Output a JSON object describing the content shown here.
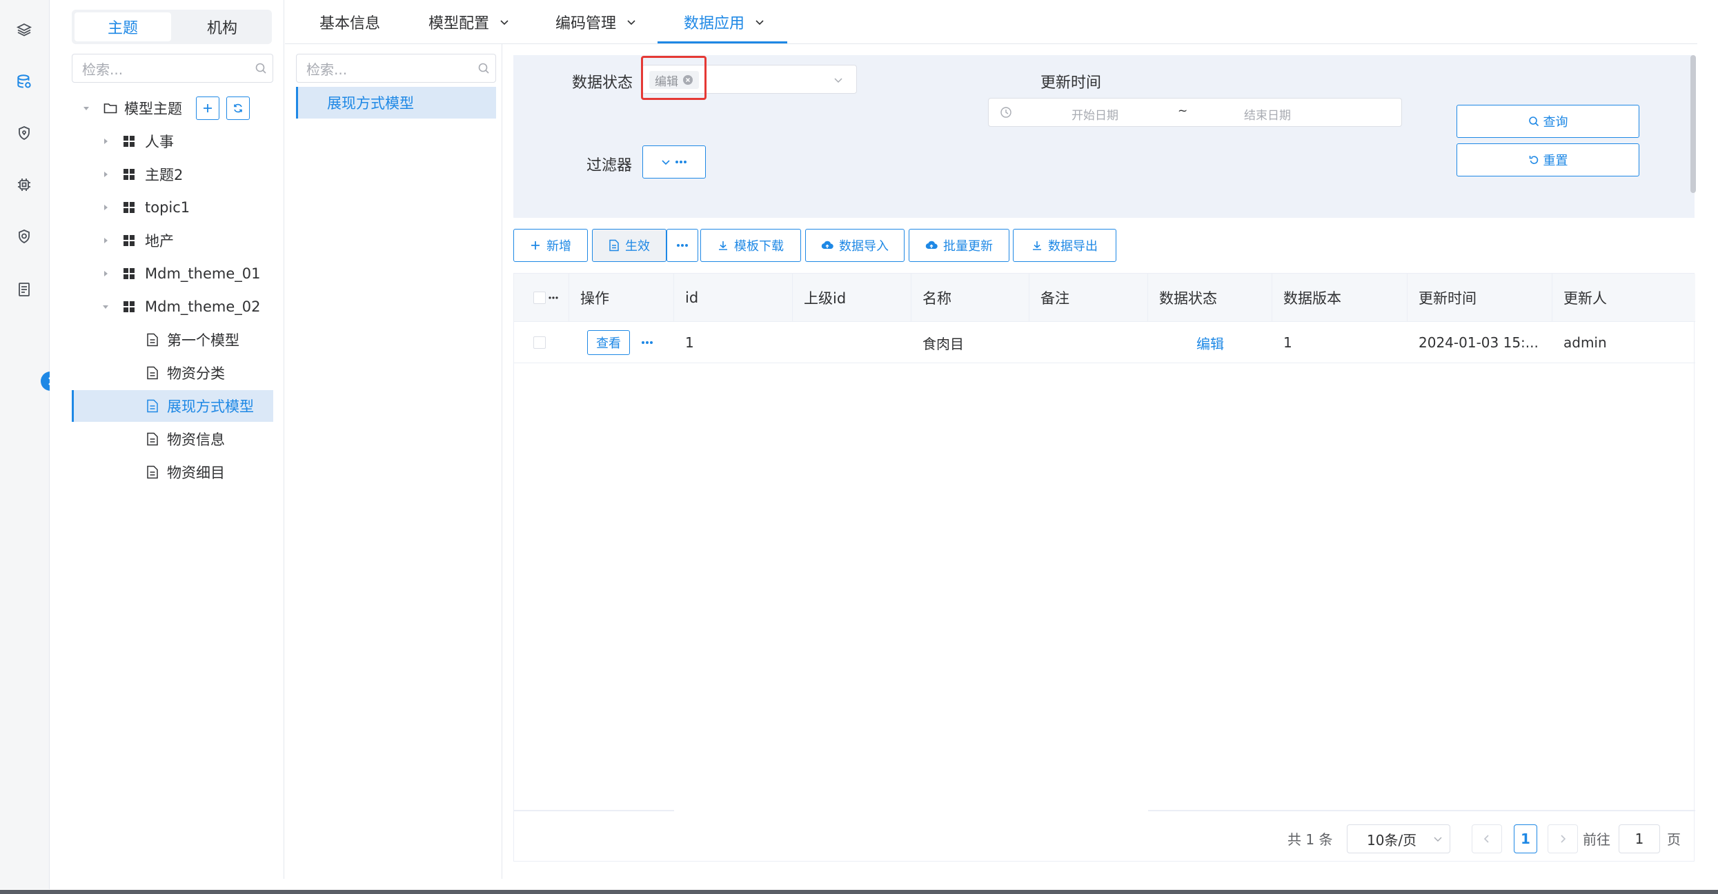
{
  "rail": {
    "icons": [
      "layers-icon",
      "database-icon",
      "shield-icon",
      "chip-icon",
      "shield-check-icon",
      "document-icon"
    ],
    "accent": "#1e88e5"
  },
  "tree_panel": {
    "segment": {
      "active": "主题",
      "inactive": "机构"
    },
    "search_placeholder": "检索...",
    "root": {
      "label": "模型主题"
    },
    "nodes": [
      {
        "label": "人事",
        "level": 1,
        "type": "theme"
      },
      {
        "label": "主题2",
        "level": 1,
        "type": "theme"
      },
      {
        "label": "topic1",
        "level": 1,
        "type": "theme"
      },
      {
        "label": "地产",
        "level": 1,
        "type": "theme"
      },
      {
        "label": "Mdm_theme_01",
        "level": 1,
        "type": "theme"
      },
      {
        "label": "Mdm_theme_02",
        "level": 1,
        "type": "theme",
        "expanded": true
      },
      {
        "label": "第一个模型",
        "level": 2,
        "type": "model"
      },
      {
        "label": "物资分类",
        "level": 2,
        "type": "model"
      },
      {
        "label": "展现方式模型",
        "level": 2,
        "type": "model",
        "selected": true
      },
      {
        "label": "物资信息",
        "level": 2,
        "type": "model"
      },
      {
        "label": "物资细目",
        "level": 2,
        "type": "model"
      }
    ]
  },
  "model_panel": {
    "search_placeholder": "检索...",
    "selected_item": "展现方式模型"
  },
  "tabs": [
    {
      "label": "基本信息",
      "dropdown": false
    },
    {
      "label": "模型配置",
      "dropdown": true
    },
    {
      "label": "编码管理",
      "dropdown": true
    },
    {
      "label": "数据应用",
      "dropdown": true,
      "active": true
    }
  ],
  "filter": {
    "status_label": "数据状态",
    "status_chip": "编辑",
    "update_time_label": "更新时间",
    "start_placeholder": "开始日期",
    "range_separator": "~",
    "end_placeholder": "结束日期",
    "filter_label": "过滤器",
    "query_button": "查询",
    "reset_button": "重置"
  },
  "toolbar": {
    "add": "新增",
    "effect": "生效",
    "template_download": "模板下载",
    "data_import": "数据导入",
    "batch_update": "批量更新",
    "data_export": "数据导出"
  },
  "table": {
    "columns": [
      "操作",
      "id",
      "上级id",
      "名称",
      "备注",
      "数据状态",
      "数据版本",
      "更新时间",
      "更新人"
    ],
    "rows": [
      {
        "action": "查看",
        "id": "1",
        "parent_id": "",
        "name": "食肉目",
        "remark": "",
        "status": "编辑",
        "version": "1",
        "update_time": "2024-01-03 15:...",
        "updater": "admin"
      }
    ]
  },
  "pagination": {
    "total_text": "共 1 条",
    "page_size": "10条/页",
    "current_page": "1",
    "goto_label": "前往",
    "goto_value": "1",
    "page_suffix": "页"
  }
}
